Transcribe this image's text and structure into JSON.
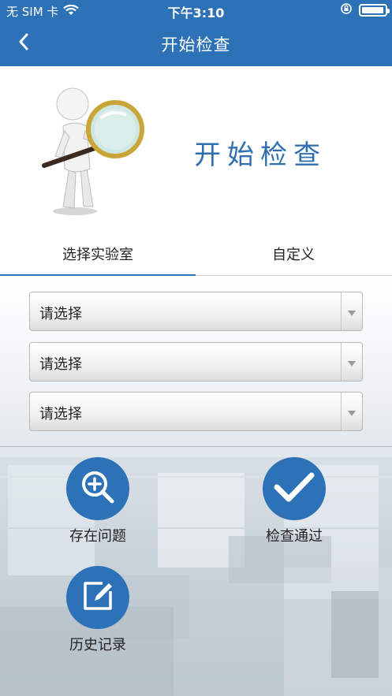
{
  "status_bar": {
    "carrier": "无 SIM 卡",
    "time": "下午3:10",
    "battery_level": 0.95
  },
  "nav": {
    "back_icon": "chevron-left-icon",
    "title": "开始检查"
  },
  "hero": {
    "illustration": "figure-with-magnifier-icon",
    "title": "开始检查"
  },
  "tabs": [
    {
      "label": "选择实验室",
      "active": true
    },
    {
      "label": "自定义",
      "active": false
    }
  ],
  "selects": [
    {
      "value": "请选择"
    },
    {
      "value": "请选择"
    },
    {
      "value": "请选择"
    }
  ],
  "actions": {
    "issue": {
      "label": "存在问题",
      "icon": "zoom-in-icon"
    },
    "pass": {
      "label": "检查通过",
      "icon": "checkmark-icon"
    },
    "history": {
      "label": "历史记录",
      "icon": "edit-icon"
    }
  },
  "colors": {
    "brand": "#2d72b7",
    "hero_title": "#2f6fb0"
  }
}
